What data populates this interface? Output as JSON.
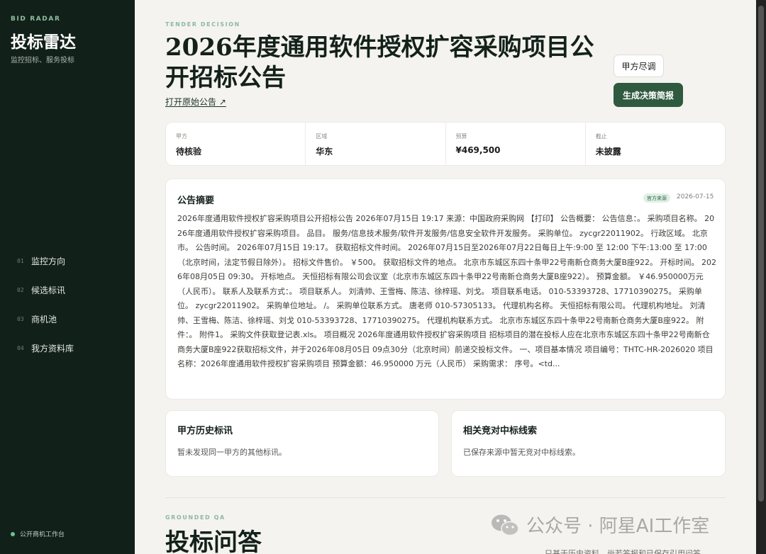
{
  "sidebar": {
    "brand_en": "BID RADAR",
    "brand_cn": "投标雷达",
    "brand_sub": "监控招标、服务投标",
    "items": [
      {
        "num": "01",
        "label": "监控方向"
      },
      {
        "num": "02",
        "label": "候选标讯"
      },
      {
        "num": "03",
        "label": "商机池"
      },
      {
        "num": "04",
        "label": "我方资料库"
      }
    ],
    "footer": "公开商机工作台"
  },
  "main": {
    "eyebrow": "TENDER DECISION",
    "title": "2026年度通用软件授权扩容采购项目公开招标公告",
    "open_link": "打开原始公告 ↗",
    "btn_due_diligence": "甲方尽调",
    "btn_generate": "生成决策简报"
  },
  "stats": [
    {
      "label": "甲方",
      "value": "待核验"
    },
    {
      "label": "区域",
      "value": "华东"
    },
    {
      "label": "预算",
      "value": "¥469,500"
    },
    {
      "label": "截止",
      "value": "未披露"
    }
  ],
  "summary": {
    "title": "公告摘要",
    "badge": "官方来源",
    "date": "2026-07-15",
    "text": "2026年度通用软件授权扩容采购项目公开招标公告 2026年07月15日 19:17 来源：中国政府采购网 【打印】 公告概要： 公告信息：。 采购项目名称。 2026年度通用软件授权扩容采购项目。 品目。 服务/信息技术服务/软件开发服务/信息安全软件开发服务。 采购单位。 zycgr22011902。 行政区域。 北京市。 公告时间。 2026年07月15日 19:17。 获取招标文件时间。 2026年07月15日至2026年07月22日每日上午:9:00 至 12:00 下午:13:00 至 17:00（北京时间，法定节假日除外）。 招标文件售价。 ￥500。 获取招标文件的地点。 北京市东城区东四十条甲22号南新仓商务大厦B座922。 开标时间。 2026年08月05日 09:30。 开标地点。 天恒招标有限公司会议室（北京市东城区东四十条甲22号南新仓商务大厦B座922）。 预算金额。 ￥46.950000万元（人民币）。 联系人及联系方式：。 项目联系人。 刘清帅、王雪梅、陈洁、徐梓瑶、刘戈。 项目联系电话。 010-53393728、17710390275。 采购单位。 zycgr22011902。 采购单位地址。 /。 采购单位联系方式。 唐老师 010-57305133。 代理机构名称。 天恒招标有限公司。 代理机构地址。 刘清帅、王雪梅、陈洁、徐梓瑶、刘戈 010-53393728、17710390275。 代理机构联系方式。 北京市东城区东四十条甲22号南新仓商务大厦B座922。 附件：。 附件1。 采购文件获取登记表.xls。 项目概况 2026年度通用软件授权扩容采购项目 招标项目的潜在投标人应在北京市东城区东四十条甲22号南新仓商务大厦B座922获取招标文件，并于2026年08月05日 09点30分（北京时间）前递交投标文件。 一、项目基本情况 项目编号：THTC-HR-2026020 项目名称：2026年度通用软件授权扩容采购项目 预算金额：46.950000 万元（人民币） 采购需求： 序号。<td..."
  },
  "history": {
    "title": "甲方历史标讯",
    "body": "暂未发现同一甲方的其他标讯。"
  },
  "competitors": {
    "title": "相关竞对中标线索",
    "body": "已保存来源中暂无竞对中标线索。"
  },
  "qa": {
    "eyebrow": "GROUNDED QA",
    "title": "投标问答",
    "sub": "只基于历史资料，尚若答报和已保存引用问答"
  },
  "watermark": {
    "text": "公众号 · 阿星AI工作室",
    "icon": "wechat-icon"
  }
}
